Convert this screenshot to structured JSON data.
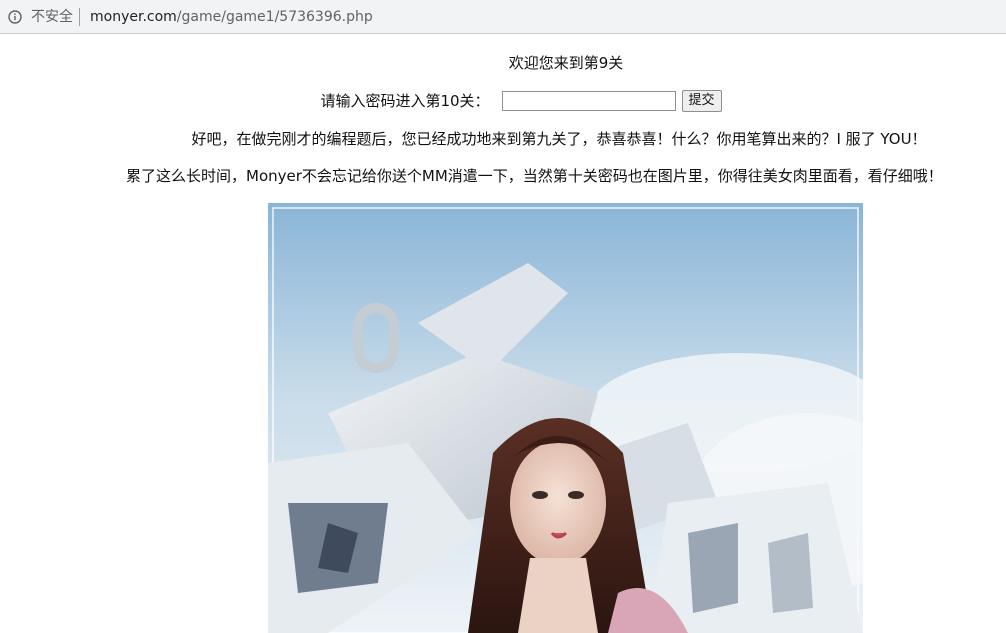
{
  "browser": {
    "security_label": "不安全",
    "url_host": "monyer.com",
    "url_path": "/game/game1/5736396.php",
    "icon": "info-icon"
  },
  "page": {
    "welcome": "欢迎您来到第9关",
    "password_label": "请输入密码进入第10关：",
    "password_value": "",
    "submit_label": "提交",
    "paragraph1": "好吧，在做完刚才的编程题后，您已经成功地来到第九关了，恭喜恭喜！什么？你用笔算出来的？I 服了 YOU！",
    "paragraph2": "累了这么长时间，Monyer不会忘记给你送个MM消遣一下，当然第十关密码也在图片里，你得往美女肉里面看，看仔细哦！"
  },
  "colors": {
    "toolbar_bg": "#f1f3f4",
    "sky_top": "#8fb8d8",
    "sky_bottom": "#dfeaf3"
  }
}
